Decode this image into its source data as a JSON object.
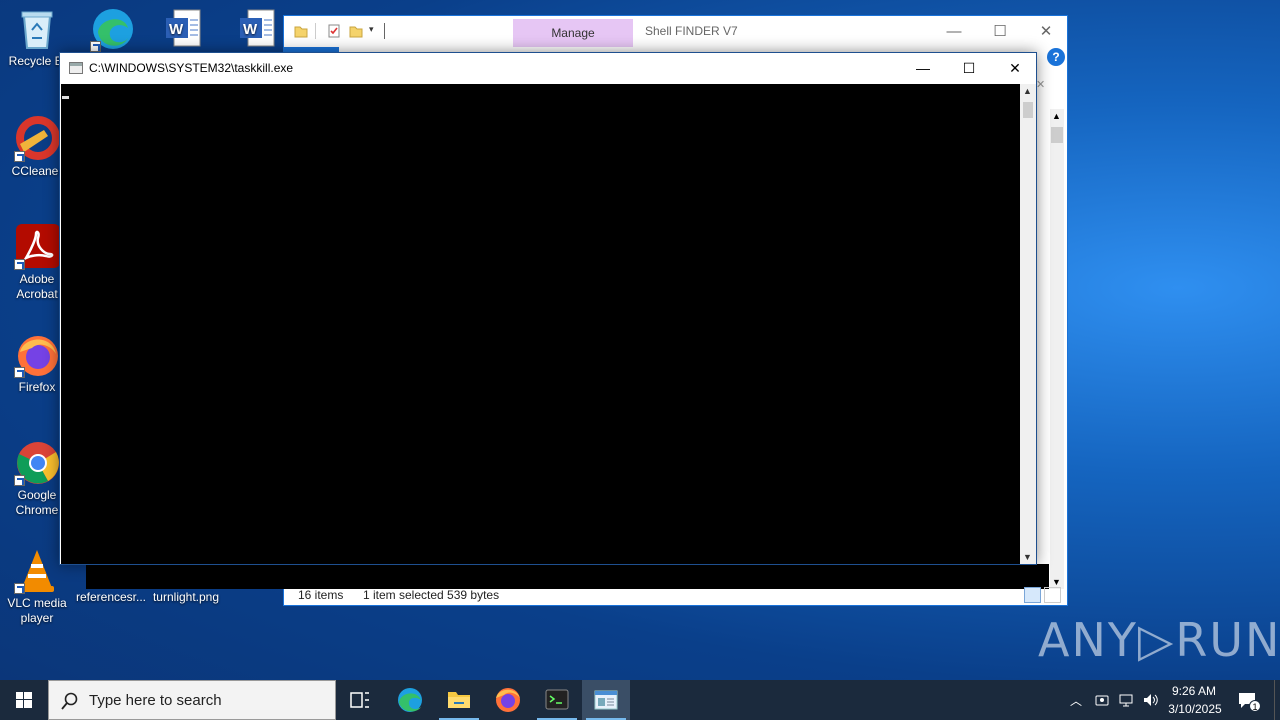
{
  "desktop": {
    "icons": [
      {
        "label": "Recycle Bi",
        "icon": "recycle-bin-icon"
      },
      {
        "label": "CCleaner",
        "icon": "ccleaner-icon"
      },
      {
        "label": "Adobe\nAcrobat",
        "icon": "adobe-acrobat-icon"
      },
      {
        "label": "Firefox",
        "icon": "firefox-icon"
      },
      {
        "label": "Google\nChrome",
        "icon": "chrome-icon"
      },
      {
        "label": "VLC media\nplayer",
        "icon": "vlc-icon"
      },
      {
        "label": "referencesr...",
        "icon": "file-icon"
      },
      {
        "label": "turnlight.png",
        "icon": "image-file-icon"
      }
    ]
  },
  "explorer": {
    "manage_tab": "Manage",
    "title": "Shell FINDER V7",
    "status": {
      "items": "16 items",
      "selected": "1 item selected  539 bytes"
    }
  },
  "console": {
    "title": "C:\\WINDOWS\\SYSTEM32\\taskkill.exe",
    "minimize": "—",
    "maximize": "☐",
    "close": "✕"
  },
  "taskbar": {
    "search_placeholder": "Type here to search",
    "time": "9:26 AM",
    "date": "3/10/2025",
    "notification_count": "1"
  },
  "watermark": "ANY▷RUN",
  "colors": {
    "desktop_accent": "#1565c0",
    "manage_tab": "#e6c6f4",
    "console_bg": "#000000",
    "taskbar_bg": "#1b2a3d"
  }
}
